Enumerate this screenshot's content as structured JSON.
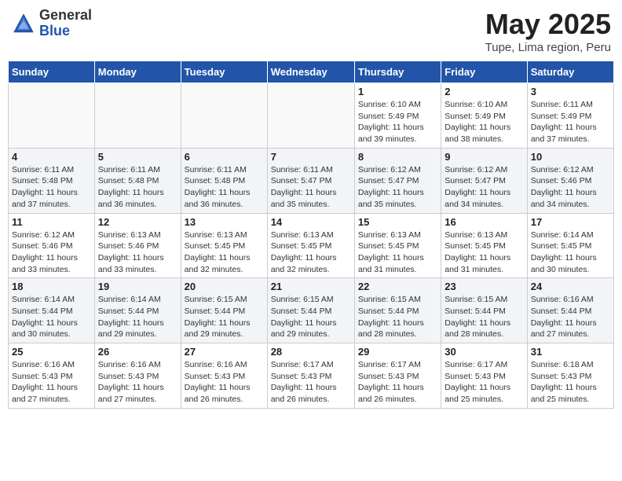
{
  "header": {
    "logo_general": "General",
    "logo_blue": "Blue",
    "month_title": "May 2025",
    "location": "Tupe, Lima region, Peru"
  },
  "days_of_week": [
    "Sunday",
    "Monday",
    "Tuesday",
    "Wednesday",
    "Thursday",
    "Friday",
    "Saturday"
  ],
  "weeks": [
    [
      {
        "day": "",
        "info": ""
      },
      {
        "day": "",
        "info": ""
      },
      {
        "day": "",
        "info": ""
      },
      {
        "day": "",
        "info": ""
      },
      {
        "day": "1",
        "info": "Sunrise: 6:10 AM\nSunset: 5:49 PM\nDaylight: 11 hours and 39 minutes."
      },
      {
        "day": "2",
        "info": "Sunrise: 6:10 AM\nSunset: 5:49 PM\nDaylight: 11 hours and 38 minutes."
      },
      {
        "day": "3",
        "info": "Sunrise: 6:11 AM\nSunset: 5:49 PM\nDaylight: 11 hours and 37 minutes."
      }
    ],
    [
      {
        "day": "4",
        "info": "Sunrise: 6:11 AM\nSunset: 5:48 PM\nDaylight: 11 hours and 37 minutes."
      },
      {
        "day": "5",
        "info": "Sunrise: 6:11 AM\nSunset: 5:48 PM\nDaylight: 11 hours and 36 minutes."
      },
      {
        "day": "6",
        "info": "Sunrise: 6:11 AM\nSunset: 5:48 PM\nDaylight: 11 hours and 36 minutes."
      },
      {
        "day": "7",
        "info": "Sunrise: 6:11 AM\nSunset: 5:47 PM\nDaylight: 11 hours and 35 minutes."
      },
      {
        "day": "8",
        "info": "Sunrise: 6:12 AM\nSunset: 5:47 PM\nDaylight: 11 hours and 35 minutes."
      },
      {
        "day": "9",
        "info": "Sunrise: 6:12 AM\nSunset: 5:47 PM\nDaylight: 11 hours and 34 minutes."
      },
      {
        "day": "10",
        "info": "Sunrise: 6:12 AM\nSunset: 5:46 PM\nDaylight: 11 hours and 34 minutes."
      }
    ],
    [
      {
        "day": "11",
        "info": "Sunrise: 6:12 AM\nSunset: 5:46 PM\nDaylight: 11 hours and 33 minutes."
      },
      {
        "day": "12",
        "info": "Sunrise: 6:13 AM\nSunset: 5:46 PM\nDaylight: 11 hours and 33 minutes."
      },
      {
        "day": "13",
        "info": "Sunrise: 6:13 AM\nSunset: 5:45 PM\nDaylight: 11 hours and 32 minutes."
      },
      {
        "day": "14",
        "info": "Sunrise: 6:13 AM\nSunset: 5:45 PM\nDaylight: 11 hours and 32 minutes."
      },
      {
        "day": "15",
        "info": "Sunrise: 6:13 AM\nSunset: 5:45 PM\nDaylight: 11 hours and 31 minutes."
      },
      {
        "day": "16",
        "info": "Sunrise: 6:13 AM\nSunset: 5:45 PM\nDaylight: 11 hours and 31 minutes."
      },
      {
        "day": "17",
        "info": "Sunrise: 6:14 AM\nSunset: 5:45 PM\nDaylight: 11 hours and 30 minutes."
      }
    ],
    [
      {
        "day": "18",
        "info": "Sunrise: 6:14 AM\nSunset: 5:44 PM\nDaylight: 11 hours and 30 minutes."
      },
      {
        "day": "19",
        "info": "Sunrise: 6:14 AM\nSunset: 5:44 PM\nDaylight: 11 hours and 29 minutes."
      },
      {
        "day": "20",
        "info": "Sunrise: 6:15 AM\nSunset: 5:44 PM\nDaylight: 11 hours and 29 minutes."
      },
      {
        "day": "21",
        "info": "Sunrise: 6:15 AM\nSunset: 5:44 PM\nDaylight: 11 hours and 29 minutes."
      },
      {
        "day": "22",
        "info": "Sunrise: 6:15 AM\nSunset: 5:44 PM\nDaylight: 11 hours and 28 minutes."
      },
      {
        "day": "23",
        "info": "Sunrise: 6:15 AM\nSunset: 5:44 PM\nDaylight: 11 hours and 28 minutes."
      },
      {
        "day": "24",
        "info": "Sunrise: 6:16 AM\nSunset: 5:44 PM\nDaylight: 11 hours and 27 minutes."
      }
    ],
    [
      {
        "day": "25",
        "info": "Sunrise: 6:16 AM\nSunset: 5:43 PM\nDaylight: 11 hours and 27 minutes."
      },
      {
        "day": "26",
        "info": "Sunrise: 6:16 AM\nSunset: 5:43 PM\nDaylight: 11 hours and 27 minutes."
      },
      {
        "day": "27",
        "info": "Sunrise: 6:16 AM\nSunset: 5:43 PM\nDaylight: 11 hours and 26 minutes."
      },
      {
        "day": "28",
        "info": "Sunrise: 6:17 AM\nSunset: 5:43 PM\nDaylight: 11 hours and 26 minutes."
      },
      {
        "day": "29",
        "info": "Sunrise: 6:17 AM\nSunset: 5:43 PM\nDaylight: 11 hours and 26 minutes."
      },
      {
        "day": "30",
        "info": "Sunrise: 6:17 AM\nSunset: 5:43 PM\nDaylight: 11 hours and 25 minutes."
      },
      {
        "day": "31",
        "info": "Sunrise: 6:18 AM\nSunset: 5:43 PM\nDaylight: 11 hours and 25 minutes."
      }
    ]
  ]
}
